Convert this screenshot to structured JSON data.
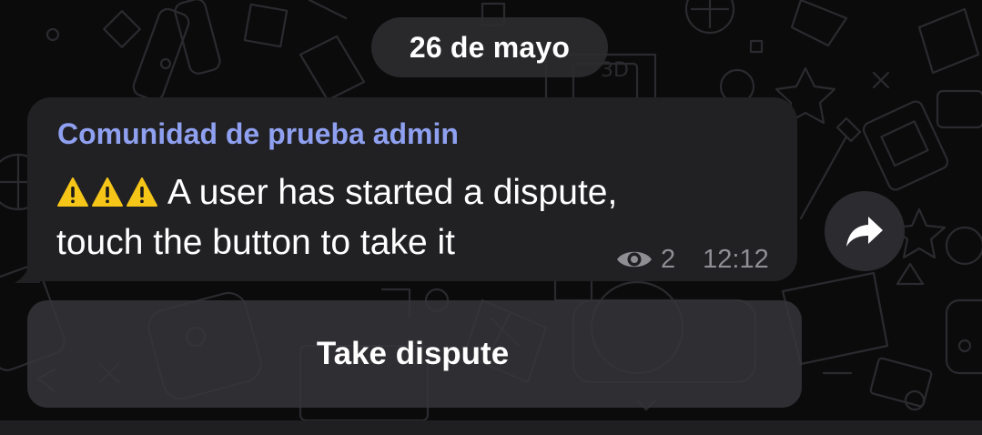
{
  "chat": {
    "date_separator": "26 de mayo",
    "message": {
      "sender": "Comunidad de prueba admin",
      "prefix_icons": [
        "warning-icon",
        "warning-icon",
        "warning-icon"
      ],
      "text_line1": "A user has started a dispute,",
      "text_line2": "touch the button to take it",
      "views": "2",
      "views_icon": "eye-icon",
      "time": "12:12"
    },
    "share_icon": "share-arrow-icon",
    "inline_button": {
      "label": "Take dispute"
    }
  },
  "colors": {
    "background": "#0b0b0c",
    "bubble": "#212124",
    "sender_name": "#8fa0f0",
    "meta_text": "#8e8e93",
    "warning": "#f5c518",
    "inline_button": "#34343a"
  }
}
